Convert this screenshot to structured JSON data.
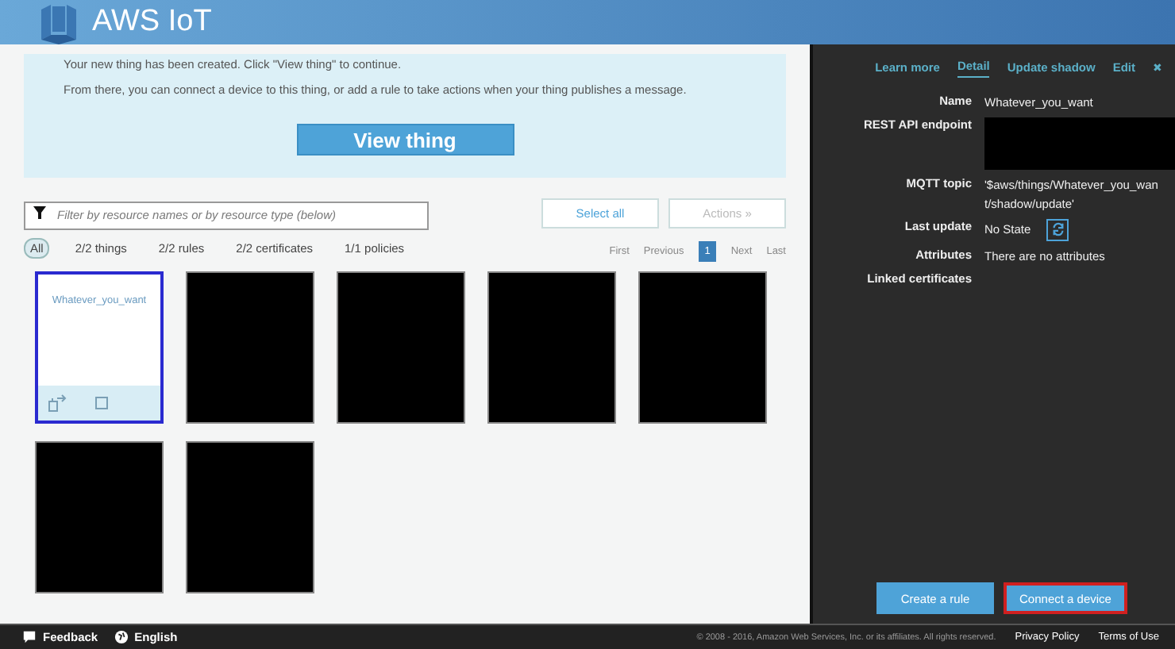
{
  "header": {
    "title": "AWS IoT"
  },
  "banner": {
    "lines": [
      "Your new thing has been created. Click \"View thing\" to continue.",
      "From there, you can connect a device to this thing, or add a rule to take actions when your thing publishes a message."
    ],
    "button": "View thing"
  },
  "filter": {
    "placeholder": "Filter by resource names or by resource type (below)"
  },
  "toolbar_buttons": [
    {
      "label": "Select all",
      "disabled": false
    },
    {
      "label": "Actions »",
      "disabled": true
    }
  ],
  "chips": [
    {
      "label": "All",
      "selected": true
    },
    {
      "label": "2/2 things",
      "selected": false
    },
    {
      "label": "2/2 rules",
      "selected": false
    },
    {
      "label": "2/2 certificates",
      "selected": false
    },
    {
      "label": "1/1 policies",
      "selected": false
    }
  ],
  "pagination": [
    {
      "label": "First",
      "selected": false
    },
    {
      "label": "Previous",
      "selected": false
    },
    {
      "label": "1",
      "selected": true
    },
    {
      "label": "Next",
      "selected": false
    },
    {
      "label": "Last",
      "selected": false
    }
  ],
  "cards": [
    {
      "kind": "thing",
      "name": "Whatever_you_want",
      "selected": true
    },
    {
      "kind": "redacted",
      "selected": false
    },
    {
      "kind": "redacted",
      "selected": false
    },
    {
      "kind": "redacted",
      "selected": false
    },
    {
      "kind": "redacted",
      "selected": false
    },
    {
      "kind": "redacted",
      "selected": false
    },
    {
      "kind": "redacted",
      "selected": false
    }
  ],
  "panel": {
    "tabs": [
      {
        "label": "Learn more",
        "selected": false
      },
      {
        "label": "Detail",
        "selected": true
      },
      {
        "label": "Update shadow",
        "selected": false
      },
      {
        "label": "Edit",
        "selected": false
      }
    ],
    "close": "✖",
    "details": [
      {
        "label": "Name",
        "kind": "text",
        "value": "Whatever_you_want"
      },
      {
        "label": "REST API endpoint",
        "kind": "redacted"
      },
      {
        "label": "MQTT topic",
        "kind": "text",
        "value": "'$aws/things/Whatever_you_want/shadow/update'"
      },
      {
        "label": "Last update",
        "kind": "refresh",
        "value": "No State"
      },
      {
        "label": "Attributes",
        "kind": "text",
        "value": "There are no attributes"
      },
      {
        "label": "Linked certificates",
        "kind": "text"
      }
    ],
    "buttons": [
      {
        "label": "Create a rule",
        "highlighted": false
      },
      {
        "label": "Connect a device",
        "highlighted": true
      }
    ]
  },
  "footer": {
    "left": [
      {
        "kind": "feedback",
        "label": "Feedback"
      },
      {
        "kind": "language",
        "label": "English"
      }
    ],
    "copyright": "© 2008 - 2016, Amazon Web Services, Inc. or its affiliates. All rights reserved.",
    "links": [
      "Privacy Policy",
      "Terms of Use"
    ]
  }
}
